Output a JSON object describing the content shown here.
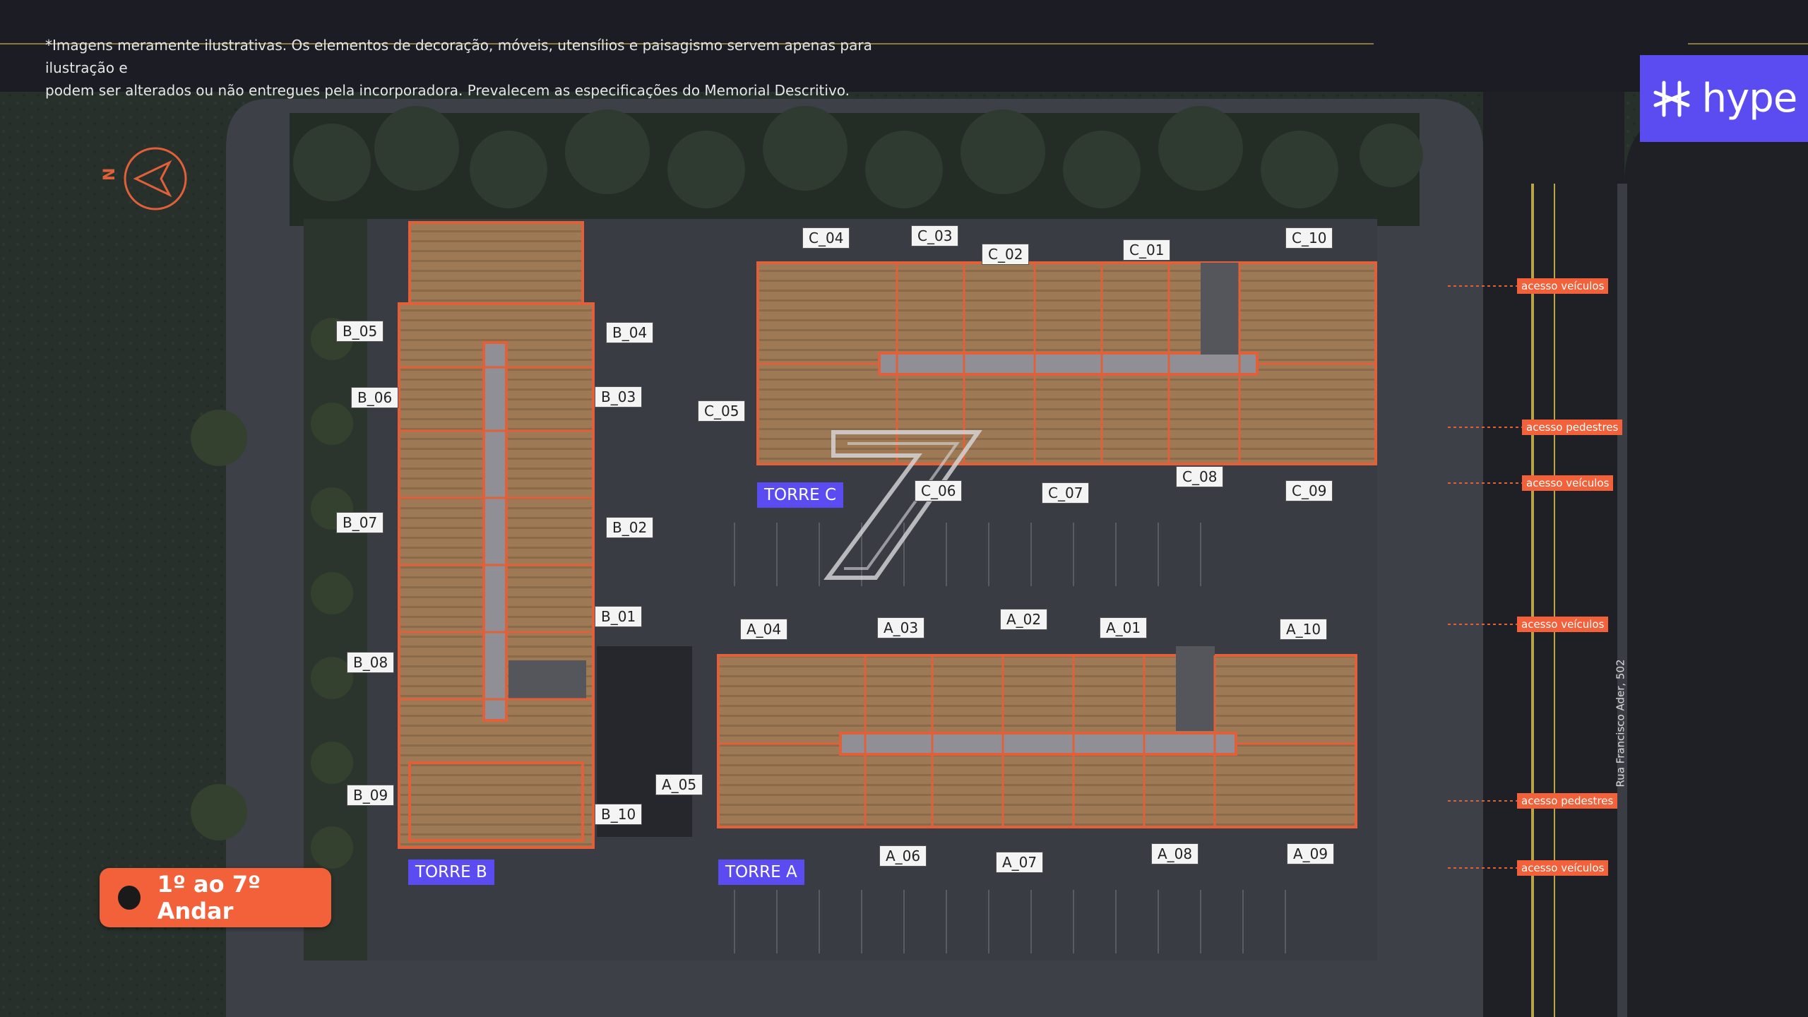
{
  "disclaimer": {
    "line1": "*Imagens meramente ilustrativas. Os elementos de decoração, móveis, utensílios e paisagismo servem apenas para ilustração e",
    "line2": "podem ser alterados ou não entregues pela incorporadora. Prevalecem as especificações do Memorial Descritivo."
  },
  "brand": {
    "name": "hype",
    "color": "#5a4cf0"
  },
  "compass": {
    "label": "N"
  },
  "floor_button": {
    "label": "1º ao 7º Andar",
    "color": "#f2613a"
  },
  "towers": {
    "a": "TORRE A",
    "b": "TORRE B",
    "c": "TORRE C"
  },
  "units_b": [
    "B_05",
    "B_04",
    "B_06",
    "B_03",
    "B_07",
    "B_02",
    "B_01",
    "B_08",
    "B_09",
    "B_10"
  ],
  "units_c": [
    "C_04",
    "C_03",
    "C_02",
    "C_01",
    "C_10",
    "C_05",
    "C_06",
    "C_07",
    "C_08",
    "C_09"
  ],
  "units_a": [
    "A_04",
    "A_03",
    "A_02",
    "A_01",
    "A_10",
    "A_05",
    "A_06",
    "A_07",
    "A_08",
    "A_09"
  ],
  "access": {
    "v1": "acesso veículos",
    "p1": "acesso pedestres",
    "v2": "acesso veículos",
    "v3": "acesso veículos",
    "p2": "acesso pedestres",
    "v4": "acesso veículos"
  },
  "street": "Rua Francisco Ader, 502",
  "colors": {
    "accent": "#f2613a",
    "brand": "#5a4cf0",
    "corridor": "#8f8f95"
  },
  "icons": [
    "compass-arrow-icon",
    "hype-logo-icon",
    "building-mark-icon"
  ]
}
